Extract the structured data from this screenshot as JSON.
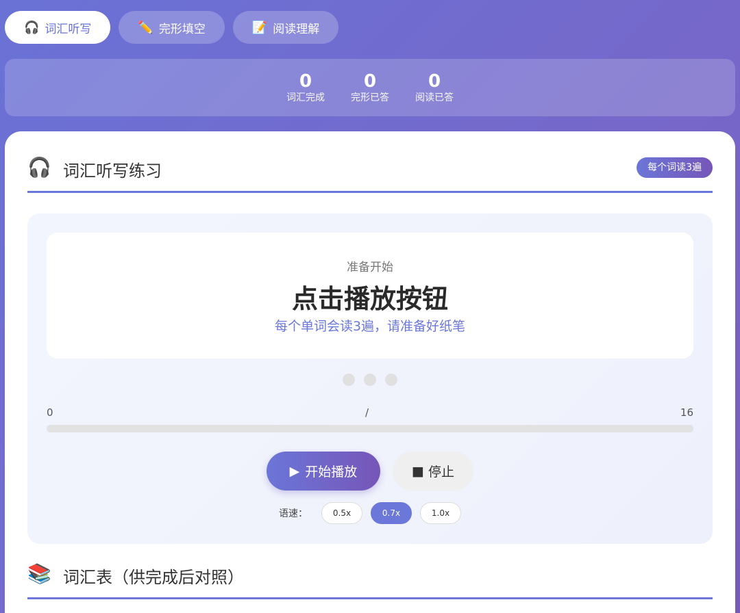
{
  "tabs": [
    {
      "icon": "🎧",
      "icon_name": "headphones-icon",
      "label": "词汇听写",
      "active": true
    },
    {
      "icon": "✏️",
      "icon_name": "pencil-icon",
      "label": "完形填空",
      "active": false
    },
    {
      "icon": "📝",
      "icon_name": "memo-icon",
      "label": "阅读理解",
      "active": false
    }
  ],
  "stats": [
    {
      "value": "0",
      "label": "词汇完成"
    },
    {
      "value": "0",
      "label": "完形已答"
    },
    {
      "value": "0",
      "label": "阅读已答"
    }
  ],
  "dictation": {
    "icon": "🎧",
    "icon_name": "headphones-icon",
    "title": "词汇听写练习",
    "badge": "每个词读3遍",
    "status": "准备开始",
    "word": "点击播放按钮",
    "hint": "每个单词会读3遍，请准备好纸笔",
    "progress": {
      "current": "0",
      "separator": "/",
      "total": "16",
      "fraction": 0
    },
    "play_label": "开始播放",
    "stop_label": "停止",
    "speed_label": "语速：",
    "speeds": [
      {
        "label": "0.5x",
        "active": false
      },
      {
        "label": "0.7x",
        "active": true
      },
      {
        "label": "1.0x",
        "active": false
      }
    ]
  },
  "vocab_section": {
    "icon": "📚",
    "icon_name": "books-icon",
    "title": "词汇表（供完成后对照）"
  },
  "colors": {
    "accent": "#6b78d9",
    "accent_end": "#7656b8"
  }
}
